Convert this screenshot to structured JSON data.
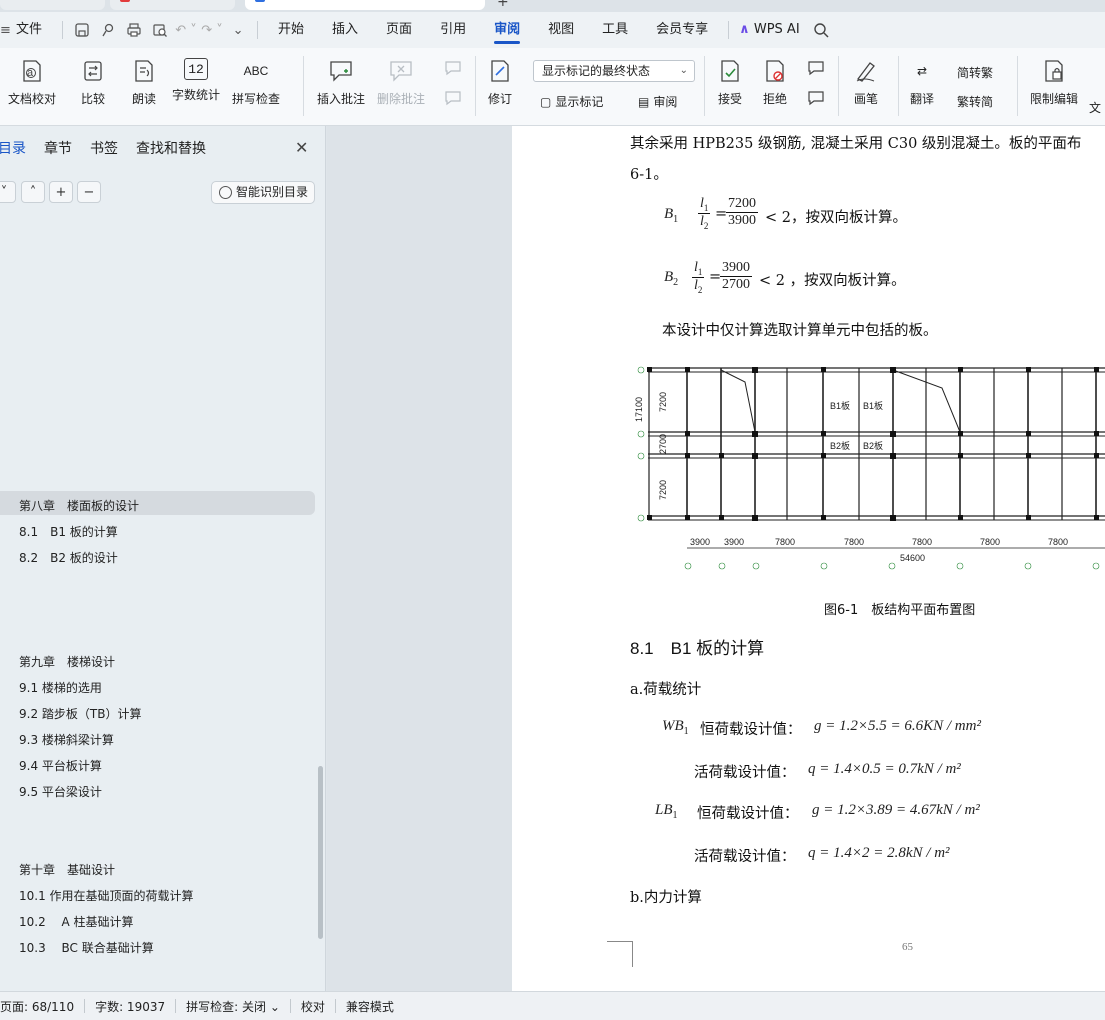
{
  "menubar": {
    "file_label": "文件",
    "tabs": [
      "开始",
      "插入",
      "页面",
      "引用",
      "审阅",
      "视图",
      "工具",
      "会员专享"
    ],
    "active_tab": "审阅",
    "wps_ai_label": "WPS AI"
  },
  "ribbon": {
    "doc_check": "文档校对",
    "compare": "比较",
    "read_aloud": "朗读",
    "word_count": "字数统计",
    "spell_check": "拼写检查",
    "insert_comment": "插入批注",
    "delete_comment": "删除批注",
    "track_changes": "修订",
    "markup_state": "显示标记的最终状态",
    "show_markup": "显示标记",
    "review": "审阅",
    "accept": "接受",
    "reject": "拒绝",
    "pen": "画笔",
    "translate": "翻译",
    "to_traditional": "简转繁",
    "to_simplified": "繁转简",
    "restrict_edit": "限制编辑",
    "doc_more": "文",
    "word_count_icon_text": "12",
    "spell_icon_text": "ABC"
  },
  "nav": {
    "tabs": [
      "目录",
      "章节",
      "书签",
      "查找和替换"
    ],
    "smart_toc": "智能识别目录",
    "items": [
      {
        "text": "第八章　楼面板的设计",
        "highlight": true
      },
      {
        "text": "8.1　B1 板的计算"
      },
      {
        "text": "8.2　B2 板的设计"
      },
      {
        "text": "第九章　楼梯设计"
      },
      {
        "text": "9.1 楼梯的选用"
      },
      {
        "text": "9.2 踏步板（TB）计算"
      },
      {
        "text": "9.3 楼梯斜梁计算"
      },
      {
        "text": "9.4 平台板计算"
      },
      {
        "text": "9.5 平台梁设计"
      },
      {
        "text": "第十章　基础设计"
      },
      {
        "text": "10.1 作用在基础顶面的荷载计算"
      },
      {
        "text": "10.2　 A 柱基础计算"
      },
      {
        "text": "10.3　 BC 联合基础计算"
      }
    ]
  },
  "doc": {
    "line1": "其余采用 HPB235 级钢筋, 混凝土采用 C30 级别混凝土。板的平面布",
    "line2": "6-1。",
    "b1": {
      "label": "B",
      "sub": "1",
      "num1": "l",
      "num1_sub": "1",
      "den1": "l",
      "den1_sub": "2",
      "eq": "=",
      "num2": "7200",
      "den2": "3900",
      "tail": "< 2，按双向板计算。"
    },
    "b2": {
      "label": "B",
      "sub": "2",
      "num1": "l",
      "num1_sub": "1",
      "den1": "l",
      "den1_sub": "2",
      "eq": "=",
      "num2": "3900",
      "den2": "2700",
      "tail": "< 2 ，按双向板计算。"
    },
    "note": "本设计中仅计算选取计算单元中包括的板。",
    "figure_caption": "图6-1　板结构平面布置图",
    "section_heading": "8.1　B1 板的计算",
    "sub_a": "a.荷载统计",
    "wb_label": "WB",
    "wb_sub": "1",
    "dead_label": "恒荷载设计值：",
    "live_label": "活荷载设计值：",
    "wb_dead": "g = 1.2×5.5 = 6.6KN / mm²",
    "wb_live": "q = 1.4×0.5 = 0.7kN / m²",
    "lb_label": "LB",
    "lb_sub": "1",
    "lb_dead": "g = 1.2×3.89 = 4.67kN / m²",
    "lb_live": "q = 1.4×2 = 2.8kN / m²",
    "sub_b": "b.内力计算",
    "page_number": "65"
  },
  "drawing": {
    "dims_bottom": [
      "3900",
      "3900",
      "7800",
      "7800",
      "7800",
      "7800",
      "7800"
    ],
    "total": "54600",
    "dims_left": [
      "7200",
      "2700",
      "7200"
    ],
    "left_total": "17100",
    "row_labels": [
      "D",
      "C",
      "B",
      "A"
    ],
    "col_labels": [
      "1",
      "2",
      "3",
      "4",
      "5",
      "6",
      "7",
      "8"
    ],
    "panel_labels": [
      "B1板",
      "B1板",
      "B2板",
      "B2板"
    ]
  },
  "status": {
    "page": "页面: 68/110",
    "words": "字数: 19037",
    "spell": "拼写检查: 关闭",
    "proofread": "校对",
    "compat": "兼容模式"
  }
}
